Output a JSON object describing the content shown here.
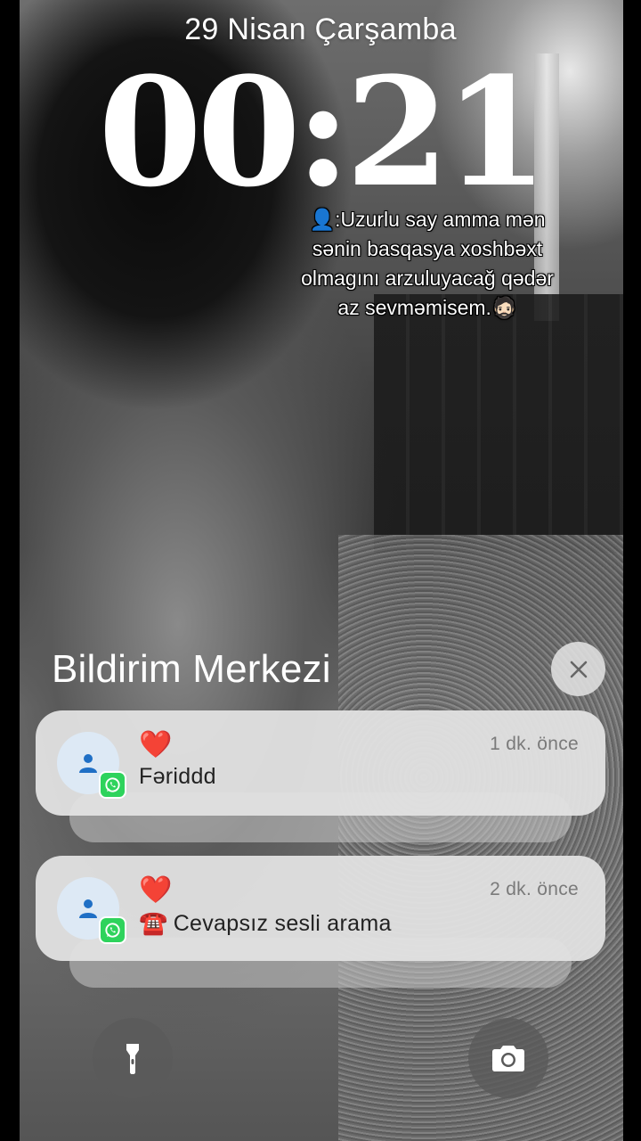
{
  "lock_screen": {
    "date": "29 Nisan Çarşamba",
    "time": "00:21",
    "caption": "👤:Uzurlu say amma mən sənin basqasya xoshbəxt olmagını arzuluyacağ qədər az sevməmisem.🧔🏻"
  },
  "notification_center": {
    "title": "Bildirim Merkezi",
    "close_icon": "close-icon"
  },
  "notifications": [
    {
      "app": "WhatsApp",
      "app_icon": "whatsapp-icon",
      "avatar_icon": "person-icon",
      "heart": "❤️",
      "message": "Fəriddd",
      "time_ago": "1 dk. önce"
    },
    {
      "app": "WhatsApp",
      "app_icon": "whatsapp-icon",
      "avatar_icon": "person-icon",
      "heart": "❤️",
      "phone": "☎️",
      "message": "Cevapsız sesli arama",
      "time_ago": "2 dk. önce"
    }
  ],
  "quick_actions": {
    "flashlight_icon": "flashlight-icon",
    "camera_icon": "camera-icon"
  },
  "colors": {
    "whatsapp_green": "#2ed35c",
    "avatar_bg": "#dde9f5",
    "avatar_glyph": "#1f6fc5",
    "card_bg": "#e2e2e2"
  }
}
